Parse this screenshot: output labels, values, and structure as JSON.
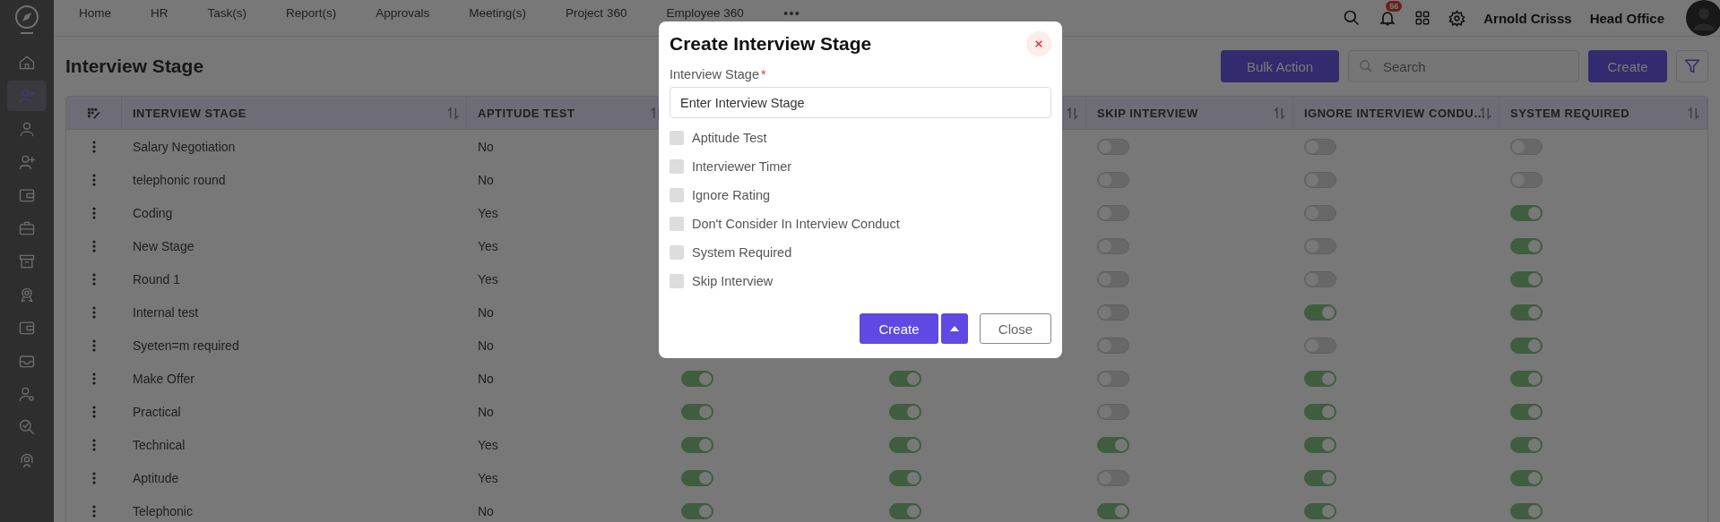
{
  "sidebar": {
    "items": [
      {
        "kind": "home",
        "selected": false
      },
      {
        "kind": "user-plus",
        "selected": true
      },
      {
        "kind": "user",
        "selected": false
      },
      {
        "kind": "user-plus",
        "selected": false
      },
      {
        "kind": "wallet",
        "selected": false
      },
      {
        "kind": "briefcase",
        "selected": false
      },
      {
        "kind": "archive",
        "selected": false
      },
      {
        "kind": "award",
        "selected": false
      },
      {
        "kind": "wallet",
        "selected": false
      },
      {
        "kind": "inbox",
        "selected": false
      },
      {
        "kind": "user-gear",
        "selected": false
      },
      {
        "kind": "search-check",
        "selected": false
      },
      {
        "kind": "headset",
        "selected": false
      }
    ]
  },
  "nav": {
    "items": [
      "Home",
      "HR",
      "Task(s)",
      "Report(s)",
      "Approvals",
      "Meeting(s)",
      "Project 360",
      "Employee 360"
    ]
  },
  "notifications": {
    "count": "56"
  },
  "user": {
    "name": "Arnold Crisss",
    "branch": "Head Office"
  },
  "page": {
    "title": "Interview Stage",
    "bulk_action": "Bulk Action",
    "search": {
      "placeholder": "Search"
    },
    "create": "Create"
  },
  "table": {
    "columns": [
      {
        "kind": "heading",
        "label": "INTERVIEW STAGE"
      },
      {
        "kind": "heading",
        "label": "APTITUDE TEST"
      },
      {
        "kind": "covered"
      },
      {
        "kind": "sort-only"
      },
      {
        "kind": "heading",
        "label": "SKIP INTERVIEW"
      },
      {
        "kind": "heading",
        "label": "IGNORE INTERVIEW CONDU…"
      },
      {
        "kind": "heading",
        "label": "SYSTEM REQUIRED"
      }
    ],
    "rows": [
      {
        "stage": "Salary Negotiation",
        "aptitude": "No",
        "skip": false,
        "ignore": false,
        "system": false
      },
      {
        "stage": "telephonic round",
        "aptitude": "No",
        "skip": false,
        "ignore": false,
        "system": false
      },
      {
        "stage": "Coding",
        "aptitude": "Yes",
        "skip": false,
        "ignore": false,
        "system": true
      },
      {
        "stage": "New Stage",
        "aptitude": "Yes",
        "skip": false,
        "ignore": false,
        "system": true
      },
      {
        "stage": "Round 1",
        "aptitude": "Yes",
        "skip": false,
        "ignore": false,
        "system": true
      },
      {
        "stage": "Internal test",
        "aptitude": "No",
        "skip": false,
        "ignore": true,
        "system": true
      },
      {
        "stage": "Syeten=m required",
        "aptitude": "No",
        "skip": false,
        "ignore": false,
        "system": true
      },
      {
        "stage": "Make Offer",
        "aptitude": "No",
        "column_3": true,
        "column_4": true,
        "skip": false,
        "ignore": true,
        "system": true
      },
      {
        "stage": "Practical",
        "aptitude": "No",
        "column_3": true,
        "column_4": true,
        "skip": false,
        "ignore": true,
        "system": true
      },
      {
        "stage": "Technical",
        "aptitude": "Yes",
        "column_3": true,
        "column_4": true,
        "skip": true,
        "ignore": true,
        "system": true
      },
      {
        "stage": "Aptitude",
        "aptitude": "Yes",
        "column_3": true,
        "column_4": true,
        "skip": false,
        "ignore": true,
        "system": true
      },
      {
        "stage": "Telephonic",
        "aptitude": "No",
        "column_3": true,
        "column_4": true,
        "skip": true,
        "ignore": true,
        "system": true
      }
    ]
  },
  "modal": {
    "title": "Create Interview Stage",
    "field": {
      "label": "Interview Stage",
      "required_mark": "*",
      "placeholder": "Enter Interview Stage"
    },
    "options": [
      {
        "label": "Aptitude Test",
        "checked": false
      },
      {
        "label": "Interviewer Timer",
        "checked": false
      },
      {
        "label": "Ignore Rating",
        "checked": false
      },
      {
        "label": "Don't Consider In Interview Conduct",
        "checked": false
      },
      {
        "label": "System Required",
        "checked": false
      },
      {
        "label": "Skip Interview",
        "checked": false
      }
    ],
    "buttons": {
      "create": "Create",
      "close": "Close"
    }
  }
}
